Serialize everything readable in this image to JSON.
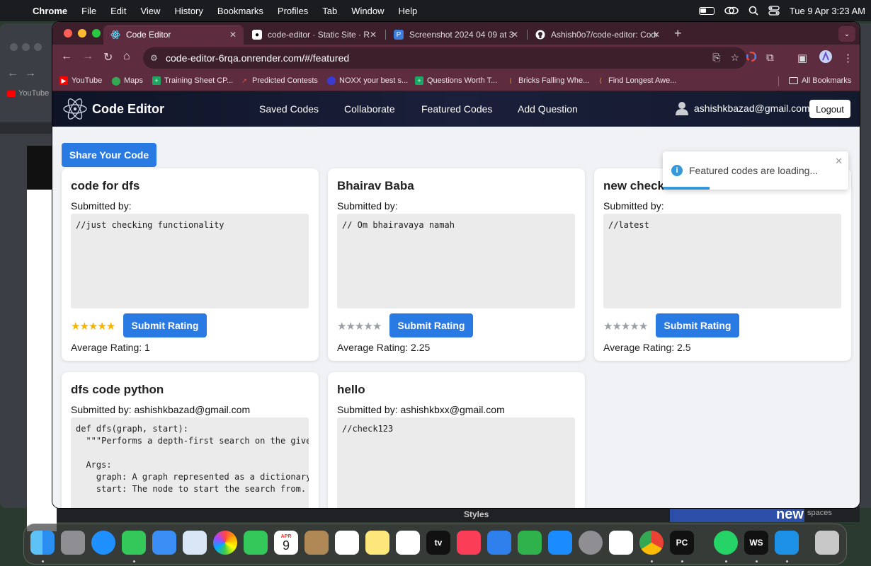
{
  "menubar": {
    "app_name": "Chrome",
    "items": [
      "File",
      "Edit",
      "View",
      "History",
      "Bookmarks",
      "Profiles",
      "Tab",
      "Window",
      "Help"
    ],
    "datetime": "Tue 9 Apr  3:23 AM"
  },
  "background": {
    "youtube_label": "YouTube",
    "styles_label": "Styles",
    "spaces_label": "spaces",
    "new_label": "new"
  },
  "tabs": [
    {
      "label": "Code Editor",
      "active": true,
      "icon": "react-icon"
    },
    {
      "label": "code-editor · Static Site · R",
      "active": false,
      "icon": "render-icon"
    },
    {
      "label": "Screenshot 2024 04 09 at 3",
      "active": false,
      "icon": "preview-icon"
    },
    {
      "label": "Ashish0o7/code-editor: Code",
      "active": false,
      "icon": "github-icon"
    }
  ],
  "address_bar": {
    "url": "code-editor-6rqa.onrender.com/#/featured"
  },
  "bookmarks": [
    {
      "label": "YouTube",
      "icon": "youtube-icon",
      "color": "#ff0000"
    },
    {
      "label": "Maps",
      "icon": "maps-icon",
      "color": "#34a853"
    },
    {
      "label": "Training Sheet CP...",
      "icon": "sheets-icon",
      "color": "#1fa463"
    },
    {
      "label": "Predicted Contests",
      "icon": "trend-icon",
      "color": "#e05a47"
    },
    {
      "label": "NOXX your best s...",
      "icon": "noxx-icon",
      "color": "#3b3bd1"
    },
    {
      "label": "Questions Worth T...",
      "icon": "sheets-icon",
      "color": "#1fa463"
    },
    {
      "label": "Bricks Falling Whe...",
      "icon": "leetcode-icon",
      "color": "#f1a33c"
    },
    {
      "label": "Find Longest Awe...",
      "icon": "leetcode-icon",
      "color": "#f1a33c"
    }
  ],
  "all_bookmarks_label": "All Bookmarks",
  "app": {
    "brand": "Code Editor",
    "nav": [
      "Saved Codes",
      "Collaborate",
      "Featured Codes",
      "Add Question"
    ],
    "user_email": "ashishkbazad@gmail.com",
    "logout_label": "Logout",
    "share_label": "Share Your Code"
  },
  "toast": {
    "message": "Featured codes are loading...",
    "progress": 0.25
  },
  "cards": [
    {
      "title": "code for dfs",
      "submitted": "Submitted by:",
      "code": "//just checking functionality",
      "stars_filled": 5,
      "rate_label": "Submit Rating",
      "avg": "Average Rating: 1"
    },
    {
      "title": "Bhairav Baba",
      "submitted": "Submitted by:",
      "code": "// Om bhairavaya namah",
      "stars_filled": 0,
      "rate_label": "Submit Rating",
      "avg": "Average Rating: 2.25"
    },
    {
      "title": "new check",
      "submitted": "Submitted by:",
      "code": "//latest",
      "stars_filled": 0,
      "rate_label": "Submit Rating",
      "avg": "Average Rating: 2.5"
    },
    {
      "title": "dfs code python",
      "submitted": "Submitted by: ashishkbazad@gmail.com",
      "code": "def dfs(graph, start):\n  \"\"\"Performs a depth-first search on the given\n\n  Args:\n    graph: A graph represented as a dictionary\n    start: The node to start the search from.\n\n  Returns:",
      "stars_filled": 0,
      "rate_label": "",
      "avg": ""
    },
    {
      "title": "hello",
      "submitted": "Submitted by: ashishkbxx@gmail.com",
      "code": "//check123",
      "stars_filled": 0,
      "rate_label": "",
      "avg": ""
    }
  ],
  "dock": {
    "calendar_month": "APR",
    "calendar_day": "9",
    "apps": [
      "finder-icon",
      "launchpad-icon",
      "safari-icon",
      "messages-icon",
      "mail-icon",
      "appstore-like-icon",
      "photos-icon",
      "facetime-icon",
      "calendar-icon",
      "contacts-icon",
      "reminders-icon",
      "notes-icon",
      "freeform-icon",
      "appletv-icon",
      "music-icon",
      "keynote-icon",
      "numbers-icon",
      "appstore-icon",
      "settings-icon",
      "vscode-icon",
      "chrome-icon",
      "pycharm-icon",
      "whatsapp-icon",
      "webstorm-icon",
      "docker-icon",
      "trash-icon"
    ],
    "tv_label": "tv",
    "pc_label": "PC",
    "ws_label": "WS"
  },
  "colors": {
    "accent": "#2a7ae4",
    "star_filled": "#f5b301",
    "star_empty": "#9aa0a6",
    "tab_bg": "#3c1f2b",
    "toolbar_bg": "#5e2c3f"
  }
}
